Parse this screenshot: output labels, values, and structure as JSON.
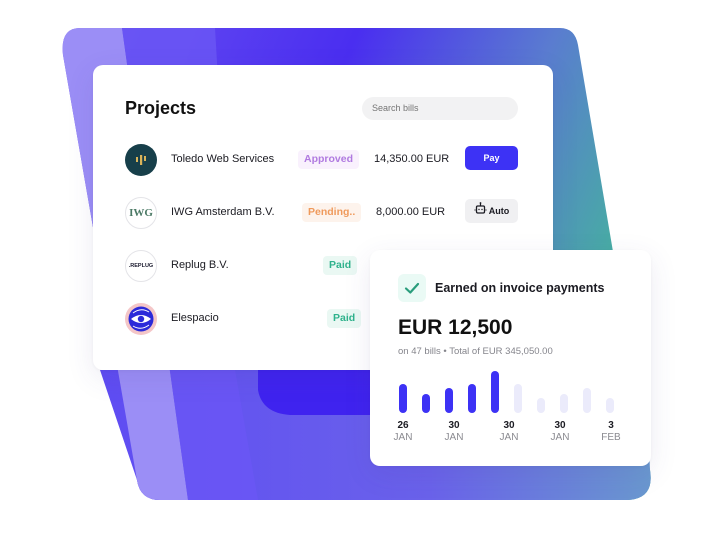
{
  "projects": {
    "title": "Projects",
    "search_placeholder": "Search bills",
    "rows": [
      {
        "name": "Toledo Web Services",
        "status": "Approved",
        "amount": "14,350.00 EUR",
        "action": "Pay",
        "logo": "toledo-logo"
      },
      {
        "name": "IWG Amsterdam B.V.",
        "status": "Pending..",
        "amount": "8,000.00 EUR",
        "action": "Auto",
        "logo": "iwg-logo",
        "logo_text": "IWG"
      },
      {
        "name": "Replug B.V.",
        "status": "Paid",
        "amount": "",
        "action": "",
        "logo": "replug-logo",
        "logo_text": ".REPLUG"
      },
      {
        "name": "Elespacio",
        "status": "Paid",
        "amount": "",
        "action": "",
        "logo": "elespacio-logo"
      }
    ]
  },
  "status_colors": {
    "Approved": {
      "fg": "#b07ae0",
      "bg": "#f9f1fd"
    },
    "Pending..": {
      "fg": "#ef9a5c",
      "bg": "#fdf3ec"
    },
    "Paid": {
      "fg": "#2fb28c",
      "bg": "#eaf8f3"
    }
  },
  "colors": {
    "accent": "#3d32f5",
    "check": "#2a9d7c"
  },
  "earned": {
    "icon": "check-icon",
    "title": "Earned on invoice payments",
    "amount": "EUR 12,500",
    "subtitle": "on 47 bills • Total of EUR 345,050.00"
  },
  "chart_data": {
    "type": "bar",
    "title": "",
    "xlabel": "",
    "ylabel": "",
    "values": [
      29,
      19,
      25,
      29,
      42,
      29,
      15,
      19,
      25,
      15
    ],
    "active": [
      true,
      true,
      true,
      true,
      true,
      false,
      false,
      false,
      false,
      false
    ],
    "tick_labels": [
      {
        "day": "26",
        "month": "JAN"
      },
      {
        "day": "30",
        "month": "JAN"
      },
      {
        "day": "30",
        "month": "JAN"
      },
      {
        "day": "30",
        "month": "JAN"
      },
      {
        "day": "3",
        "month": "FEB"
      }
    ],
    "colors": {
      "active": "#3d32f5",
      "inactive": "#ebebfb"
    },
    "grid": false
  }
}
